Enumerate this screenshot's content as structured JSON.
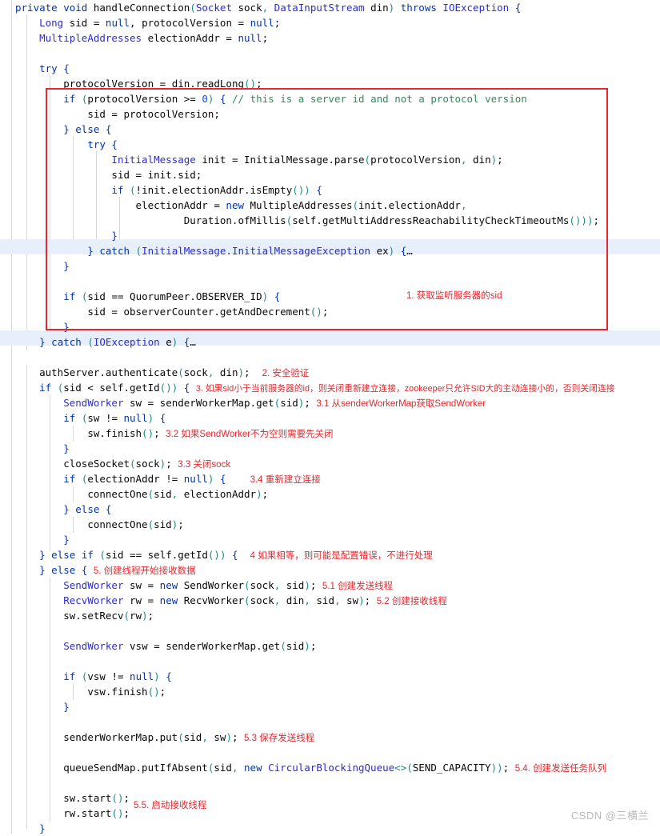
{
  "editor": {
    "language": "java",
    "method_name": "handleConnection",
    "background_color": "#ffffff",
    "highlight_color": "#e7effc",
    "annotation_color": "#e8262d",
    "keyword_color": "#0033b3",
    "type_color": "#2b2bd8",
    "comment_color": "#2e8b57",
    "paren_color": "#1a8b8b"
  },
  "watermark": {
    "text": "CSDN @三横兰"
  },
  "annotations": [
    {
      "id": "a1",
      "label": "1. 获取监听服务器的sid"
    },
    {
      "id": "a2",
      "label": "2. 安全验证"
    },
    {
      "id": "a3",
      "label": "3. 如果sid小于当前服务器的id，则关闭重新建立连接，zookeeper只允许SID大的主动连接小的，否则关闭连接"
    },
    {
      "id": "a31",
      "label": "3.1 从senderWorkerMap获取SendWorker"
    },
    {
      "id": "a32",
      "label": "3.2 如果SendWorker不为空则需要先关闭"
    },
    {
      "id": "a33",
      "label": "3.3 关闭sock"
    },
    {
      "id": "a34",
      "label": "3.4 重新建立连接"
    },
    {
      "id": "a4",
      "label": "4 如果相等，则可能是配置错误，不进行处理"
    },
    {
      "id": "a5",
      "label": "5. 创建线程开始接收数据"
    },
    {
      "id": "a51",
      "label": "5.1 创建发送线程"
    },
    {
      "id": "a52",
      "label": "5.2 创建接收线程"
    },
    {
      "id": "a53",
      "label": "5.3 保存发送线程"
    },
    {
      "id": "a54",
      "label": "5.4. 创建发送任务队列"
    },
    {
      "id": "a55",
      "label": "5.5. 启动接收线程"
    }
  ],
  "code_lines": [
    {
      "n": 1,
      "text": "private void handleConnection(Socket sock, DataInputStream din) throws IOException {"
    },
    {
      "n": 2,
      "text": "    Long sid = null, protocolVersion = null;"
    },
    {
      "n": 3,
      "text": "    MultipleAddresses electionAddr = null;"
    },
    {
      "n": 4,
      "text": ""
    },
    {
      "n": 5,
      "text": "    try {"
    },
    {
      "n": 6,
      "text": "        protocolVersion = din.readLong();"
    },
    {
      "n": 7,
      "text": "        if (protocolVersion >= 0) { // this is a server id and not a protocol version"
    },
    {
      "n": 8,
      "text": "            sid = protocolVersion;"
    },
    {
      "n": 9,
      "text": "        } else {"
    },
    {
      "n": 10,
      "text": "            try {"
    },
    {
      "n": 11,
      "text": "                InitialMessage init = InitialMessage.parse(protocolVersion, din);"
    },
    {
      "n": 12,
      "text": "                sid = init.sid;"
    },
    {
      "n": 13,
      "text": "                if (!init.electionAddr.isEmpty()) {"
    },
    {
      "n": 14,
      "text": "                    electionAddr = new MultipleAddresses(init.electionAddr,"
    },
    {
      "n": 15,
      "text": "                            Duration.ofMillis(self.getMultiAddressReachabilityCheckTimeoutMs()));"
    },
    {
      "n": 16,
      "text": "                }"
    },
    {
      "n": 17,
      "text": "            } catch (InitialMessage.InitialMessageException ex) {…"
    },
    {
      "n": 18,
      "text": "        }"
    },
    {
      "n": 19,
      "text": ""
    },
    {
      "n": 20,
      "text": "        if (sid == QuorumPeer.OBSERVER_ID) {"
    },
    {
      "n": 21,
      "text": "            sid = observerCounter.getAndDecrement();"
    },
    {
      "n": 22,
      "text": "        }"
    },
    {
      "n": 23,
      "text": "    } catch (IOException e) {…"
    },
    {
      "n": 24,
      "text": ""
    },
    {
      "n": 25,
      "text": "    authServer.authenticate(sock, din);"
    },
    {
      "n": 26,
      "text": "    if (sid < self.getId()) {"
    },
    {
      "n": 27,
      "text": "        SendWorker sw = senderWorkerMap.get(sid);"
    },
    {
      "n": 28,
      "text": "        if (sw != null) {"
    },
    {
      "n": 29,
      "text": "            sw.finish();"
    },
    {
      "n": 30,
      "text": "        }"
    },
    {
      "n": 31,
      "text": "        closeSocket(sock);"
    },
    {
      "n": 32,
      "text": "        if (electionAddr != null) {"
    },
    {
      "n": 33,
      "text": "            connectOne(sid, electionAddr);"
    },
    {
      "n": 34,
      "text": "        } else {"
    },
    {
      "n": 35,
      "text": "            connectOne(sid);"
    },
    {
      "n": 36,
      "text": "        }"
    },
    {
      "n": 37,
      "text": "    } else if (sid == self.getId()) {"
    },
    {
      "n": 38,
      "text": "    } else {"
    },
    {
      "n": 39,
      "text": "        SendWorker sw = new SendWorker(sock, sid);"
    },
    {
      "n": 40,
      "text": "        RecvWorker rw = new RecvWorker(sock, din, sid, sw);"
    },
    {
      "n": 41,
      "text": "        sw.setRecv(rw);"
    },
    {
      "n": 42,
      "text": ""
    },
    {
      "n": 43,
      "text": "        SendWorker vsw = senderWorkerMap.get(sid);"
    },
    {
      "n": 44,
      "text": ""
    },
    {
      "n": 45,
      "text": "        if (vsw != null) {"
    },
    {
      "n": 46,
      "text": "            vsw.finish();"
    },
    {
      "n": 47,
      "text": "        }"
    },
    {
      "n": 48,
      "text": ""
    },
    {
      "n": 49,
      "text": "        senderWorkerMap.put(sid, sw);"
    },
    {
      "n": 50,
      "text": ""
    },
    {
      "n": 51,
      "text": "        queueSendMap.putIfAbsent(sid, new CircularBlockingQueue<>(SEND_CAPACITY));"
    },
    {
      "n": 52,
      "text": ""
    },
    {
      "n": 53,
      "text": "        sw.start();"
    },
    {
      "n": 54,
      "text": "        rw.start();"
    },
    {
      "n": 55,
      "text": "    }"
    }
  ]
}
